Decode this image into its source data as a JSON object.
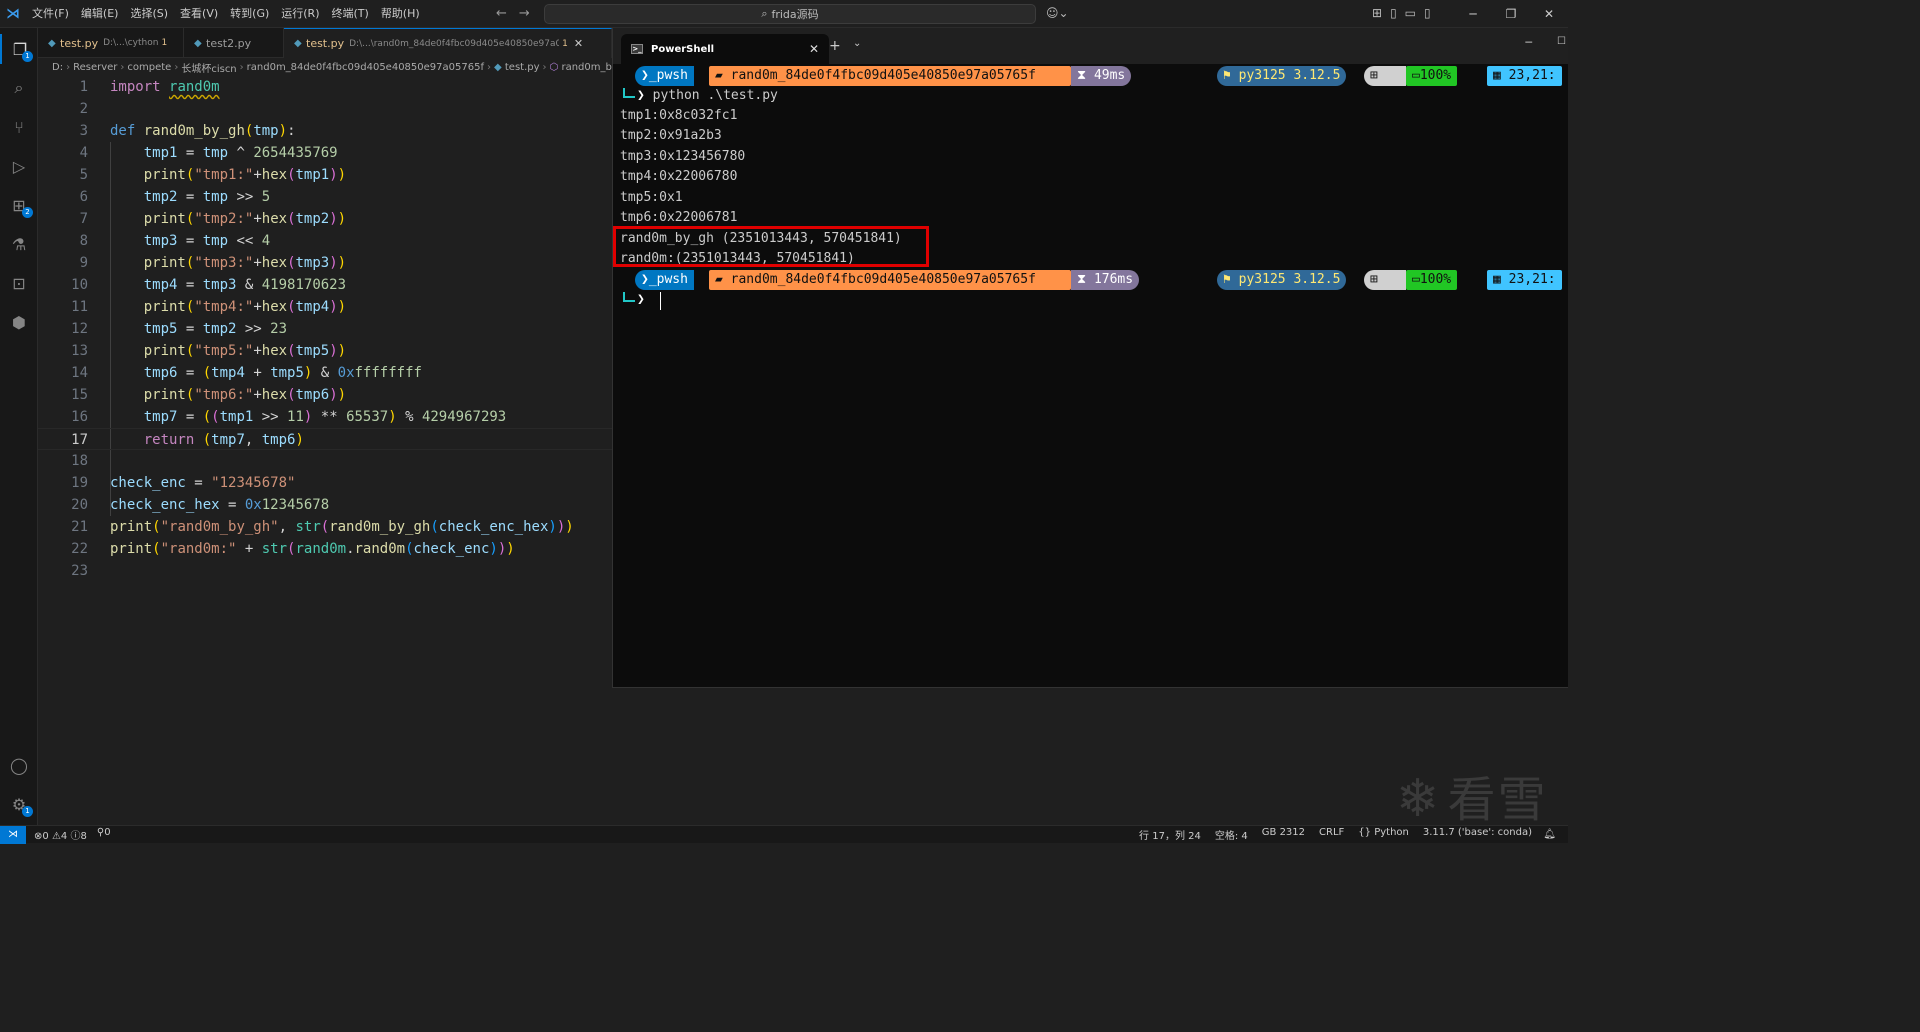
{
  "menu": [
    "文件(F)",
    "编辑(E)",
    "选择(S)",
    "查看(V)",
    "转到(G)",
    "运行(R)",
    "终端(T)",
    "帮助(H)"
  ],
  "search": {
    "text": "frida源码"
  },
  "tabs": [
    {
      "label": "test.py",
      "desc": "D:\\...\\cython",
      "count": "1",
      "active": false
    },
    {
      "label": "test2.py",
      "desc": "",
      "count": "",
      "active": false
    },
    {
      "label": "test.py",
      "desc": "D:\\...\\rand0m_84de0f4fbc09d405e40850e97a05765f",
      "count": "1",
      "active": true
    }
  ],
  "breadcrumb": [
    "D:",
    "Reserver",
    "compete",
    "长城杯ciscn",
    "rand0m_84de0f4fbc09d405e40850e97a05765f",
    "test.py",
    "rand0m_by_"
  ],
  "activity_badges": {
    "explorer": "1",
    "extensions": "2",
    "settings": "1"
  },
  "editor": {
    "current_line": 17
  },
  "terminal": {
    "tab_title": "PowerShell",
    "command": "python .\\test.py",
    "output": [
      "tmp1:0x8c032fc1",
      "tmp2:0x91a2b3",
      "tmp3:0x123456780",
      "tmp4:0x22006780",
      "tmp5:0x1",
      "tmp6:0x22006781",
      "rand0m_by_gh (2351013443, 570451841)",
      "rand0m:(2351013443, 570451841)"
    ],
    "prompt1": {
      "shell": "pwsh",
      "folder": "rand0m_84de0f4fbc09d405e40850e97a05765f",
      "time": "49ms",
      "python": "py3125  3.12.5",
      "battery": "100%",
      "date": "23,21:"
    },
    "prompt2": {
      "shell": "pwsh",
      "folder": "rand0m_84de0f4fbc09d405e40850e97a05765f",
      "time": "176ms",
      "python": "py3125  3.12.5",
      "battery": "100%",
      "date": "23,21:"
    }
  },
  "status": {
    "errors": "0",
    "warnings": "4",
    "infos": "8",
    "ports": "0",
    "position": "行 17，列 24",
    "spaces": "空格: 4",
    "encoding": "GB 2312",
    "eol": "CRLF",
    "language": "Python",
    "interpreter": "3.11.7 ('base': conda)"
  },
  "watermark": "看雪",
  "colors": {
    "accent": "#0078d4",
    "highlight": "#e00000",
    "terminal_bg": "#0c0c0c"
  }
}
